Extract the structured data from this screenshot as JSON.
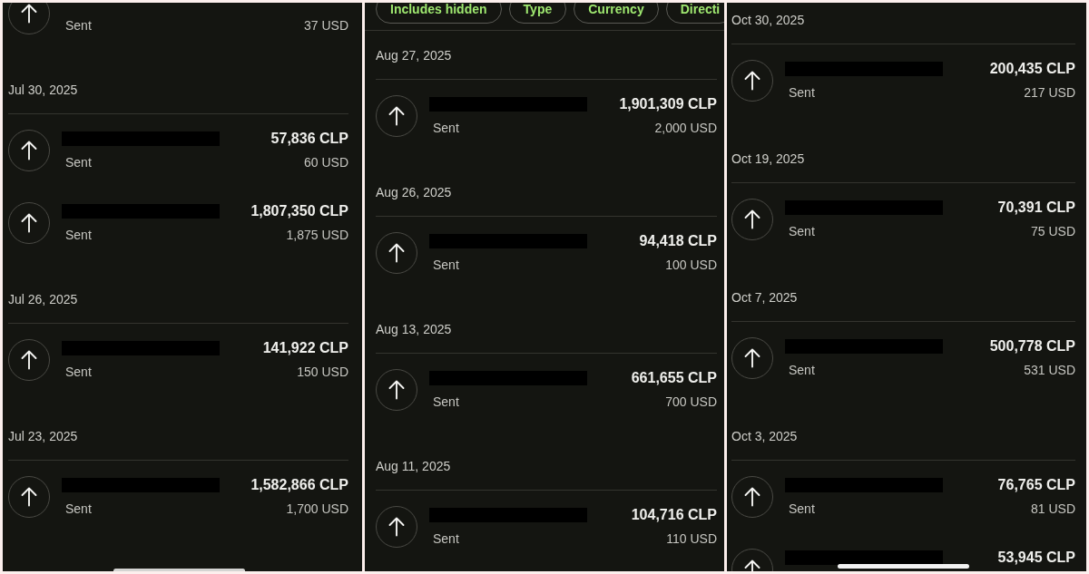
{
  "panels": [
    {
      "groups": [
        {
          "transactions": [
            {
              "status": "Sent",
              "converted": "37 USD",
              "name_redacted": false
            }
          ]
        },
        {
          "date": "Jul 30, 2025",
          "transactions": [
            {
              "amount": "57,836 CLP",
              "status": "Sent",
              "converted": "60 USD",
              "name_redacted": true
            },
            {
              "amount": "1,807,350 CLP",
              "status": "Sent",
              "converted": "1,875 USD",
              "name_redacted": true
            }
          ]
        },
        {
          "date": "Jul 26, 2025",
          "transactions": [
            {
              "amount": "141,922 CLP",
              "status": "Sent",
              "converted": "150 USD",
              "name_redacted": true
            }
          ]
        },
        {
          "date": "Jul 23, 2025",
          "transactions": [
            {
              "amount": "1,582,866 CLP",
              "status": "Sent",
              "converted": "1,700 USD",
              "name_redacted": true
            }
          ]
        }
      ],
      "home_indicator": true
    },
    {
      "filter_chips": [
        "Includes hidden",
        "Type",
        "Currency",
        "Directi"
      ],
      "groups": [
        {
          "date": "Aug 27, 2025",
          "transactions": [
            {
              "amount": "1,901,309 CLP",
              "status": "Sent",
              "converted": "2,000 USD",
              "name_redacted": true
            }
          ]
        },
        {
          "date": "Aug 26, 2025",
          "transactions": [
            {
              "amount": "94,418 CLP",
              "status": "Sent",
              "converted": "100 USD",
              "name_redacted": true
            }
          ]
        },
        {
          "date": "Aug 13, 2025",
          "transactions": [
            {
              "amount": "661,655 CLP",
              "status": "Sent",
              "converted": "700 USD",
              "name_redacted": true
            }
          ]
        },
        {
          "date": "Aug 11, 2025",
          "transactions": [
            {
              "amount": "104,716 CLP",
              "status": "Sent",
              "converted": "110 USD",
              "name_redacted": true
            }
          ]
        }
      ],
      "home_indicator": false
    },
    {
      "groups": [
        {
          "date": "Oct 30, 2025",
          "transactions": [
            {
              "amount": "200,435 CLP",
              "status": "Sent",
              "converted": "217 USD",
              "name_redacted": true
            }
          ]
        },
        {
          "date": "Oct 19, 2025",
          "transactions": [
            {
              "amount": "70,391 CLP",
              "status": "Sent",
              "converted": "75 USD",
              "name_redacted": true
            }
          ]
        },
        {
          "date": "Oct 7, 2025",
          "transactions": [
            {
              "amount": "500,778 CLP",
              "status": "Sent",
              "converted": "531 USD",
              "name_redacted": true
            }
          ]
        },
        {
          "date": "Oct 3, 2025",
          "transactions": [
            {
              "amount": "76,765 CLP",
              "status": "Sent",
              "converted": "81 USD",
              "name_redacted": true
            },
            {
              "amount": "53,945 CLP",
              "name_redacted": true
            }
          ]
        }
      ],
      "home_indicator": true
    }
  ]
}
